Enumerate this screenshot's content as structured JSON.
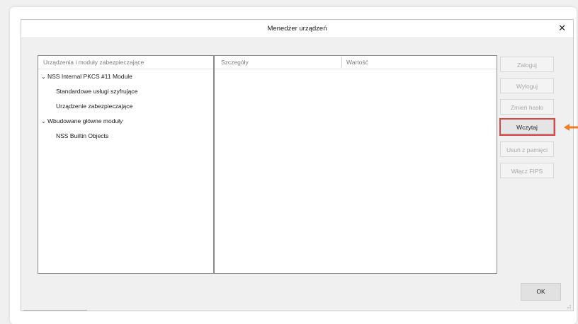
{
  "window": {
    "title": "Menedżer urządzeń"
  },
  "tree": {
    "header": "Urządzenia i moduły zabezpieczające",
    "items": [
      {
        "label": "NSS Internal PKCS #11 Module",
        "expanded": true
      },
      {
        "label": "Standardowe usługi szyfrujące"
      },
      {
        "label": "Urządzenie zabezpieczające"
      },
      {
        "label": "Wbudowane główne moduły",
        "expanded": true
      },
      {
        "label": "NSS Builtin Objects"
      }
    ]
  },
  "details": {
    "col1": "Szczegóły",
    "col2": "Wartość"
  },
  "buttons": {
    "login": "Zaloguj",
    "logout": "Wyloguj",
    "change_password": "Zmień hasło",
    "load": "Wczytaj",
    "unload": "Usuń z pamięci",
    "enable_fips": "Włącz FIPS",
    "ok": "OK"
  },
  "colors": {
    "highlight": "#e04646",
    "arrow": "#f07c24"
  },
  "icons": {
    "close": "close-icon",
    "expand": "chevron-down-icon",
    "pointer": "arrow-left-icon"
  }
}
